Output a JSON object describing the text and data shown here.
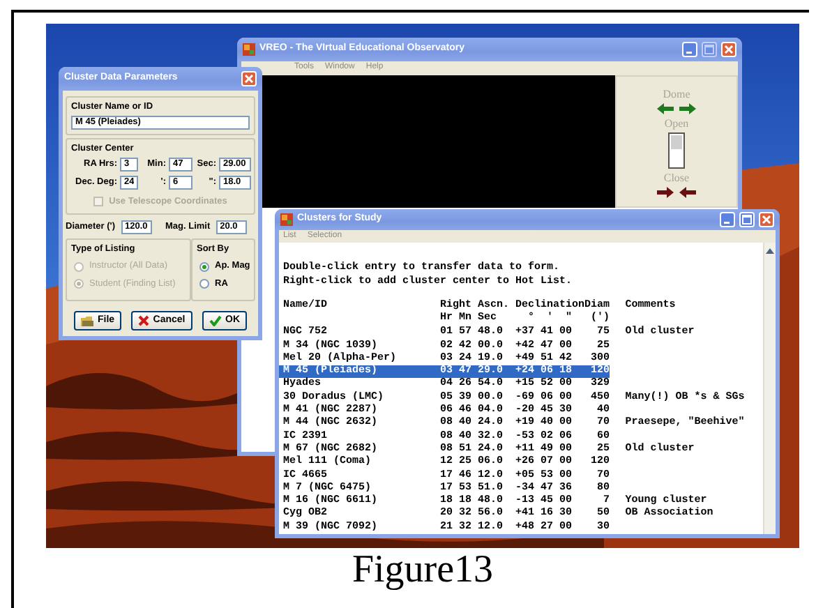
{
  "main_window": {
    "title": "VREO - The VIrtual Educational Observatory",
    "title_buttons": [
      {
        "kind": "minimize",
        "disabled": false
      },
      {
        "kind": "maximize",
        "disabled": true
      },
      {
        "kind": "close",
        "disabled": false
      }
    ],
    "menu": [
      "Tools",
      "Window",
      "Help"
    ],
    "dome_panel": {
      "dome_label": "Dome",
      "open_label": "Open",
      "close_label": "Close",
      "switch_on": true
    }
  },
  "params_dialog": {
    "title": "Cluster Data Parameters",
    "name_group": {
      "label": "Cluster Name or ID",
      "value": "M 45 (Pleiades)"
    },
    "center_group": {
      "label": "Cluster Center",
      "fields": [
        {
          "label": "RA Hrs:",
          "value": "3"
        },
        {
          "label": "Min:",
          "value": "47"
        },
        {
          "label": "Sec:",
          "value": "29.00"
        },
        {
          "label": "Dec. Deg:",
          "value": "24"
        },
        {
          "label": "':",
          "value": "6"
        },
        {
          "label": "\":",
          "value": "18.0"
        }
      ],
      "checkbox": {
        "label": "Use Telescope Coordinates",
        "checked": false,
        "disabled": true
      }
    },
    "size_fields": [
      {
        "label": "Diameter (')",
        "value": "120.0"
      },
      {
        "label": "Mag. Limit",
        "value": "20.0"
      }
    ],
    "listing_group": {
      "label": "Type of Listing",
      "options": [
        {
          "label": "Instructor (All Data)",
          "selected": false,
          "disabled": true
        },
        {
          "label": "Student (Finding List)",
          "selected": true,
          "disabled": true
        }
      ]
    },
    "sort_group": {
      "label": "Sort By",
      "options": [
        {
          "label": "Ap. Mag",
          "selected": true,
          "disabled": false
        },
        {
          "label": "RA",
          "selected": false,
          "disabled": false
        }
      ]
    },
    "buttons": [
      {
        "kind": "file",
        "label": "File"
      },
      {
        "kind": "cancel",
        "label": "Cancel"
      },
      {
        "kind": "ok",
        "label": "OK"
      }
    ]
  },
  "clusters_window": {
    "title": "Clusters for Study",
    "title_buttons": [
      {
        "kind": "minimize",
        "disabled": false
      },
      {
        "kind": "maximize",
        "disabled": false
      },
      {
        "kind": "close",
        "disabled": false
      }
    ],
    "menu": [
      "List",
      "Selection"
    ],
    "instructions": [
      "Double-click entry to transfer data to form.",
      "Right-click to add cluster center to Hot List."
    ],
    "columns": [
      {
        "title": "Name/ID"
      },
      {
        "title": "Right Ascn.",
        "units": "Hr Mn Sec"
      },
      {
        "title": "Declination",
        "units": "°  '  \""
      },
      {
        "title": "Diam",
        "units": "(')"
      },
      {
        "title": "Comments"
      }
    ],
    "rows": [
      {
        "name": "NGC 752",
        "ra": "01 57 48.0",
        "dec": "+37 41 00",
        "diam": "75",
        "comments": "Old cluster",
        "selected": false
      },
      {
        "name": "M 34 (NGC 1039)",
        "ra": "02 42 00.0",
        "dec": "+42 47 00",
        "diam": "25",
        "selected": false
      },
      {
        "name": "Mel 20 (Alpha-Per)",
        "ra": "03 24 19.0",
        "dec": "+49 51 42",
        "diam": "300",
        "selected": false
      },
      {
        "name": "M 45 (Pleiades)",
        "ra": "03 47 29.0",
        "dec": "+24 06 18",
        "diam": "120",
        "selected": true
      },
      {
        "name": "Hyades",
        "ra": "04 26 54.0",
        "dec": "+15 52 00",
        "diam": "329",
        "selected": false
      },
      {
        "name": "30 Doradus (LMC)",
        "ra": "05 39 00.0",
        "dec": "-69 06 00",
        "diam": "450",
        "comments": "Many(!) OB *s & SGs",
        "selected": false
      },
      {
        "name": "M 41 (NGC 2287)",
        "ra": "06 46 04.0",
        "dec": "-20 45 30",
        "diam": "40",
        "selected": false
      },
      {
        "name": "M 44 (NGC 2632)",
        "ra": "08 40 24.0",
        "dec": "+19 40 00",
        "diam": "70",
        "comments": "Praesepe, \"Beehive\"",
        "selected": false
      },
      {
        "name": "IC 2391",
        "ra": "08 40 32.0",
        "dec": "-53 02 06",
        "diam": "60",
        "selected": false
      },
      {
        "name": "M 67 (NGC 2682)",
        "ra": "08 51 24.0",
        "dec": "+11 49 00",
        "diam": "25",
        "comments": "Old cluster",
        "selected": false
      },
      {
        "name": "Mel 111 (Coma)",
        "ra": "12 25 06.0",
        "dec": "+26 07 00",
        "diam": "120",
        "selected": false
      },
      {
        "name": "IC 4665",
        "ra": "17 46 12.0",
        "dec": "+05 53 00",
        "diam": "70",
        "selected": false
      },
      {
        "name": "M 7 (NGC 6475)",
        "ra": "17 53 51.0",
        "dec": "-34 47 36",
        "diam": "80",
        "selected": false
      },
      {
        "name": "M 16 (NGC 6611)",
        "ra": "18 18 48.0",
        "dec": "-13 45 00",
        "diam": "7",
        "comments": "Young cluster",
        "selected": false
      },
      {
        "name": "Cyg OB2",
        "ra": "20 32 56.0",
        "dec": "+41 16 30",
        "diam": "50",
        "comments": "OB Association",
        "selected": false
      },
      {
        "name": "M 39 (NGC 7092)",
        "ra": "21 32 12.0",
        "dec": "+48 27 00",
        "diam": "30",
        "selected": false
      }
    ]
  },
  "figure": {
    "caption": "Figure13"
  }
}
